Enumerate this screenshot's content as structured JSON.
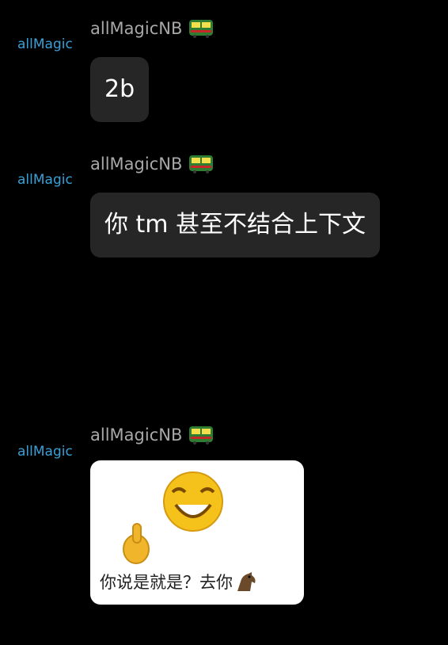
{
  "messages": [
    {
      "avatar_label": "allMagic",
      "sender": "allMagicNB",
      "sender_icon": "train-icon",
      "text": "2b"
    },
    {
      "avatar_label": "allMagic",
      "sender": "allMagicNB",
      "sender_icon": "train-icon",
      "text": "你 tm 甚至不结合上下文"
    },
    {
      "avatar_label": "allMagic",
      "sender": "allMagicNB",
      "sender_icon": "train-icon",
      "sticker_caption": "你说是就是？去你"
    }
  ],
  "colors": {
    "background": "#000000",
    "bubble": "#262626",
    "avatar_label": "#3aa0d8",
    "sender": "#a8a8a8"
  }
}
